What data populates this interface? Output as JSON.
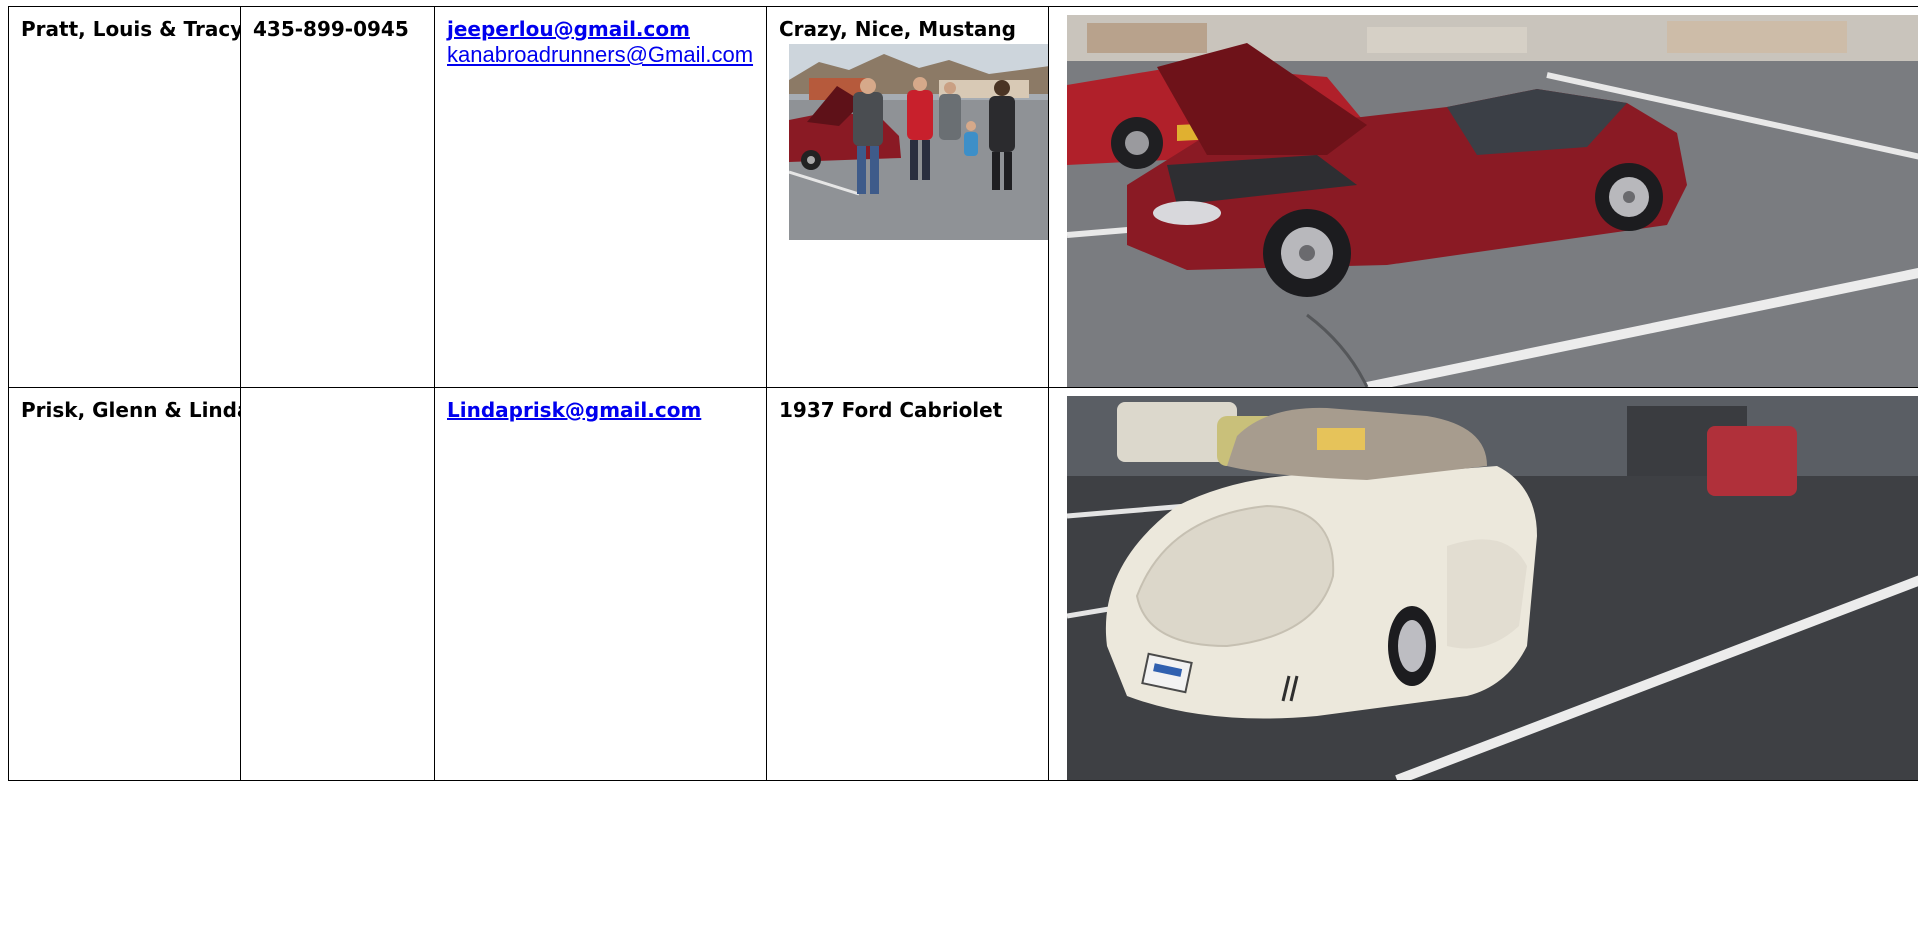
{
  "rows": [
    {
      "name": "Pratt, Louis & Tracy",
      "phone": "435-899-0945",
      "email_primary": "jeeperlou@gmail.com",
      "email_secondary": "kanabroadrunners@Gmail.com",
      "vehicle": "Crazy, Nice, Mustang"
    },
    {
      "name": "Prisk, Glenn & Linda",
      "phone": "",
      "email_primary": "Lindaprisk@gmail.com",
      "vehicle": "1937 Ford Cabriolet"
    }
  ],
  "icons": {
    "group_photo": "group-at-car-show-photo",
    "mustang_photo": "red-mustang-photo",
    "cabriolet_photo": "white-ford-cabriolet-photo"
  },
  "colors": {
    "link": "#0000ee",
    "border": "#000000",
    "mustang_red": "#8a1a24",
    "cabriolet_cream": "#ece8dc",
    "asphalt": "#6f6f72"
  }
}
